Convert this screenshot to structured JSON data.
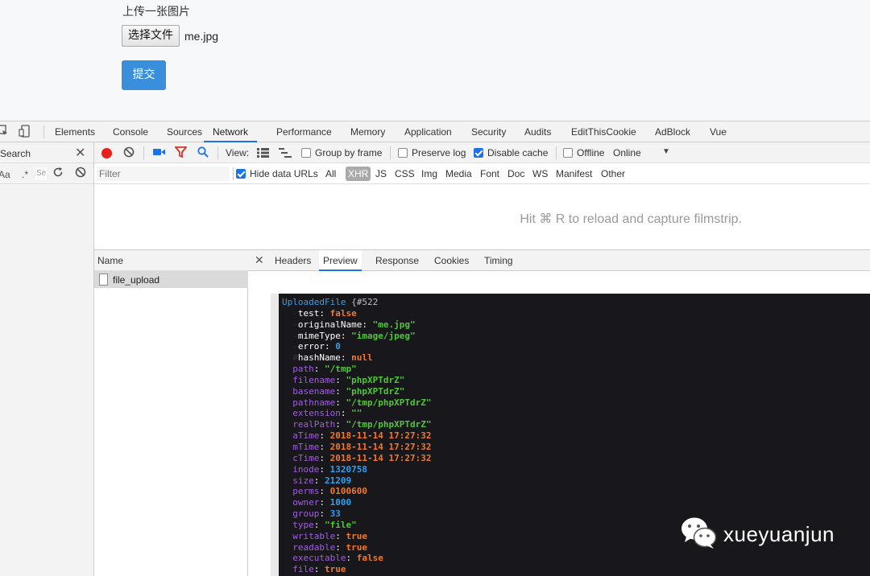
{
  "page": {
    "upload_title": "上传一张图片",
    "file_button": "选择文件",
    "file_name": "me.jpg",
    "submit_button": "提交"
  },
  "devtools": {
    "tabs": [
      "Elements",
      "Console",
      "Sources",
      "Network",
      "Performance",
      "Memory",
      "Application",
      "Security",
      "Audits",
      "EditThisCookie",
      "AdBlock",
      "Vue"
    ],
    "active_tab": "Network",
    "sidebar": {
      "search_label": "Search",
      "opt_case": "Aa",
      "opt_regex": ".*",
      "search_placeholder": "Se"
    },
    "toolbar": {
      "view_label": "View:",
      "group_by_frame": "Group by frame",
      "preserve_log": "Preserve log",
      "disable_cache": "Disable cache",
      "offline": "Offline",
      "throttle": "Online"
    },
    "filterbar": {
      "filter_placeholder": "Filter",
      "hide_data_urls": "Hide data URLs",
      "types": [
        "All",
        "XHR",
        "JS",
        "CSS",
        "Img",
        "Media",
        "Font",
        "Doc",
        "WS",
        "Manifest",
        "Other"
      ]
    },
    "filmstrip_message": "Hit ⌘ R to reload and capture filmstrip.",
    "name_header": "Name",
    "request": "file_upload",
    "detail_tabs": [
      "Headers",
      "Preview",
      "Response",
      "Cookies",
      "Timing"
    ],
    "active_detail_tab": "Preview"
  },
  "dump": {
    "class": "UploadedFile",
    "id": "#522",
    "lines": [
      {
        "prefix": "-",
        "key": "test",
        "value": "false",
        "type": "false"
      },
      {
        "prefix": "-",
        "key": "originalName",
        "value": "\"me.jpg\"",
        "type": "str"
      },
      {
        "prefix": "-",
        "key": "mimeType",
        "value": "\"image/jpeg\"",
        "type": "str"
      },
      {
        "prefix": "-",
        "key": "error",
        "value": "0",
        "type": "int"
      },
      {
        "prefix": "#",
        "key": "hashName",
        "value": "null",
        "type": "false"
      },
      {
        "prefix": "",
        "key": "path",
        "value": "\"/tmp\"",
        "type": "str"
      },
      {
        "prefix": "",
        "key": "filename",
        "value": "\"phpXPTdrZ\"",
        "type": "str"
      },
      {
        "prefix": "",
        "key": "basename",
        "value": "\"phpXPTdrZ\"",
        "type": "str"
      },
      {
        "prefix": "",
        "key": "pathname",
        "value": "\"/tmp/phpXPTdrZ\"",
        "type": "str"
      },
      {
        "prefix": "",
        "key": "extension",
        "value": "\"\"",
        "type": "str"
      },
      {
        "prefix": "",
        "key": "realPath",
        "value": "\"/tmp/phpXPTdrZ\"",
        "type": "str"
      },
      {
        "prefix": "",
        "key": "aTime",
        "value": "2018-11-14 17:27:32",
        "type": "date"
      },
      {
        "prefix": "",
        "key": "mTime",
        "value": "2018-11-14 17:27:32",
        "type": "date"
      },
      {
        "prefix": "",
        "key": "cTime",
        "value": "2018-11-14 17:27:32",
        "type": "date"
      },
      {
        "prefix": "",
        "key": "inode",
        "value": "1320758",
        "type": "int"
      },
      {
        "prefix": "",
        "key": "size",
        "value": "21209",
        "type": "int"
      },
      {
        "prefix": "",
        "key": "perms",
        "value": "0100600",
        "type": "date"
      },
      {
        "prefix": "",
        "key": "owner",
        "value": "1000",
        "type": "int"
      },
      {
        "prefix": "",
        "key": "group",
        "value": "33",
        "type": "int"
      },
      {
        "prefix": "",
        "key": "type",
        "value": "\"file\"",
        "type": "str"
      },
      {
        "prefix": "",
        "key": "writable",
        "value": "true",
        "type": "false"
      },
      {
        "prefix": "",
        "key": "readable",
        "value": "true",
        "type": "false"
      },
      {
        "prefix": "",
        "key": "executable",
        "value": "false",
        "type": "false"
      },
      {
        "prefix": "",
        "key": "file",
        "value": "true",
        "type": "false"
      }
    ]
  },
  "watermark": "xueyuanjun"
}
